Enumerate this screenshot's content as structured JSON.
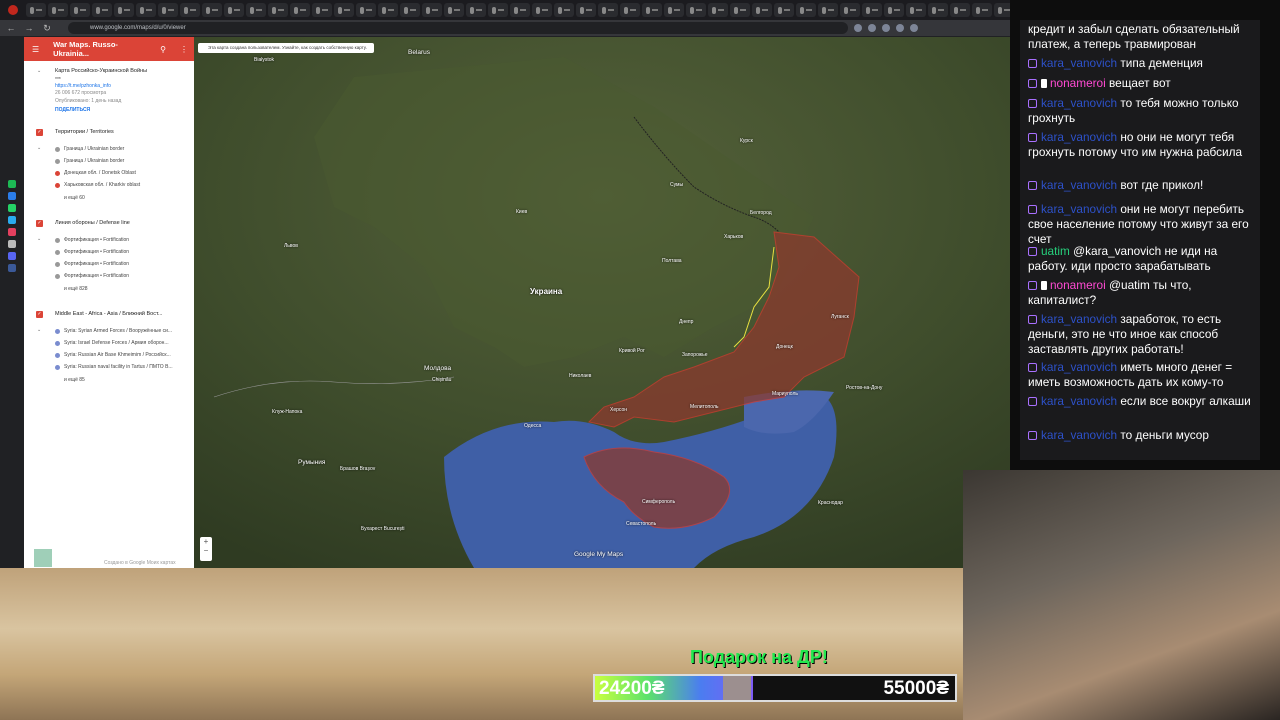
{
  "browser": {
    "url": "www.google.com/maps/d/u/0/viewer"
  },
  "sidebar": {
    "title": "War Maps. Russo-Ukrainia...",
    "map_name": "Карта Российско-Украинской Войны",
    "map_sub": "***",
    "map_link": "https://t.me/pzhonka_info",
    "views": "26 006 672 просмотра",
    "published": "Опубликовано: 1 день назад",
    "share": "ПОДЕЛИТЬСЯ",
    "layers": [
      {
        "title": "Территории / Territories",
        "items": [
          "Граница / Ukrainian border",
          "Граница / Ukrainian border",
          "Донецкая обл. / Donetsk Oblast",
          "Харьковская обл. / Kharkiv oblast"
        ],
        "more": "и ещё 60"
      },
      {
        "title": "Линия обороны / Defense line",
        "items": [
          "Фортификация • Fortification",
          "Фортификация • Fortification",
          "Фортификация • Fortification",
          "Фортификация • Fortification"
        ],
        "more": "и ещё 828"
      },
      {
        "title": "Middle East - Africa - Asia / Ближний Вост...",
        "items": [
          "Syria: Syrian Armed Forces / Вооружённые си...",
          "Syria: Israel Defense Forces / Армия оборон...",
          "Syria: Russian Air Base Khmeimim / Российск...",
          "Syria: Russian naval facility in Tartus / ПМТО В..."
        ],
        "more": "и ещё 85"
      }
    ],
    "footer": "Создано в Google Моих картах"
  },
  "map": {
    "banner": "Эта карта создана пользователем. Узнайте, как создать собственную карту.",
    "watermark": "Google My Maps",
    "labels": {
      "belarus": "Belarus",
      "ukraine": "Украина",
      "moldova": "Молдова",
      "romania": "Румыния",
      "bialystok": "Białystok",
      "kyiv": "Киев",
      "kharkiv": "Харьков",
      "dnipro": "Днепр",
      "zaporizhzhia": "Запорожье",
      "donetsk": "Донецк",
      "odesa": "Одесса",
      "mykolaiv": "Николаев",
      "kryvyi_rih": "Кривой Рог",
      "poltava": "Полтава",
      "luhansk": "Луганск",
      "mariupol": "Мариуполь",
      "sevastopol": "Севастополь",
      "simferopol": "Симферополь",
      "rostov": "Ростов-на-Дону",
      "krasnodar": "Краснодар",
      "kursk": "Курск",
      "belgorod": "Белгород",
      "lviv": "Львов",
      "chisinau": "Chișinău",
      "bucharest": "Бухарест București",
      "brasov": "Брашов Brașov",
      "cluj": "Клуж-Напока",
      "sumy": "Сумы",
      "melitopol": "Мелитополь",
      "kherson": "Херсон"
    }
  },
  "chat": [
    {
      "name": "",
      "text": "кредит и забыл сделать обязательный платеж, а теперь травмирован",
      "color": "",
      "badge": false
    },
    {
      "name": "kara_vanovich",
      "text": "типа деменция",
      "color": "blue",
      "badge": true
    },
    {
      "name": "nonameroi",
      "text": "вещает вот",
      "color": "red",
      "badge": true
    },
    {
      "name": "kara_vanovich",
      "text": "то тебя можно только грохнуть",
      "color": "blue",
      "badge": true
    },
    {
      "name": "kara_vanovich",
      "text": "но они не могут тебя грохнуть потому что им нужна рабсила",
      "color": "blue",
      "badge": true
    },
    {
      "name": "kara_vanovich",
      "text": "вот где прикол!",
      "color": "blue",
      "badge": true
    },
    {
      "name": "kara_vanovich",
      "text": "они не могут перебить свое население потому что живут за его счет",
      "color": "blue",
      "badge": true
    },
    {
      "name": "uatim",
      "text": "@kara_vanovich не иди на работу. иди просто зарабатывать",
      "color": "green",
      "badge": true
    },
    {
      "name": "nonameroi",
      "text": "@uatim ты что, капиталист?",
      "color": "red",
      "badge": true
    },
    {
      "name": "kara_vanovich",
      "text": "заработок, то есть деньги, это не что иное как способ заставлять других работать!",
      "color": "blue",
      "badge": true
    },
    {
      "name": "kara_vanovich",
      "text": "иметь много денег = иметь возможность дать их кому-то",
      "color": "blue",
      "badge": true
    },
    {
      "name": "kara_vanovich",
      "text": "если все вокруг алкаши",
      "color": "blue",
      "badge": true
    },
    {
      "name": "kara_vanovich",
      "text": "то деньги мусор",
      "color": "blue",
      "badge": true
    }
  ],
  "goal": {
    "title": "Подарок на ДР!",
    "current": "24200₴",
    "target": "55000₴",
    "progress": 0.44
  }
}
